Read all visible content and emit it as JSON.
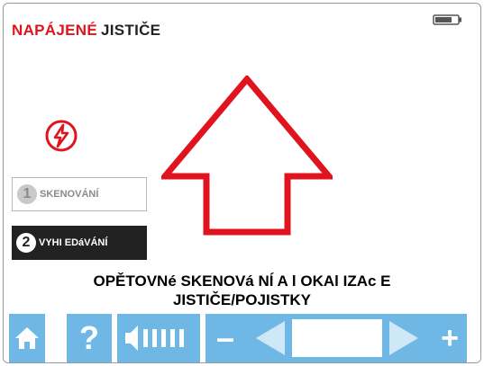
{
  "header": {
    "title_red": "NAPÁJENÉ",
    "title_dark": "JISTIČE",
    "battery_icon": "battery-icon"
  },
  "status_icon": "lightning-warning-icon",
  "direction_icon": "up-arrow-icon",
  "modes": [
    {
      "number": "1",
      "label": "SKENOVÁNÍ",
      "active": false
    },
    {
      "number": "2",
      "label": "VYHI EDáVÁNÍ",
      "active": true
    }
  ],
  "instruction": {
    "line1": "OPĚTOVNé SKENOVá NÍ A l OKAl IZAc E",
    "line2": "JISTIČE/POJISTKY"
  },
  "toolbar": {
    "home_icon": "home-icon",
    "help_label": "?",
    "volume_icon": "volume-icon",
    "minus_label": "–",
    "plus_label": "+",
    "prev_icon": "triangle-left-icon",
    "next_icon": "triangle-right-icon"
  },
  "colors": {
    "accent_red": "#e0141e",
    "toolbar_blue": "#6fb8e6",
    "dark": "#222222"
  }
}
